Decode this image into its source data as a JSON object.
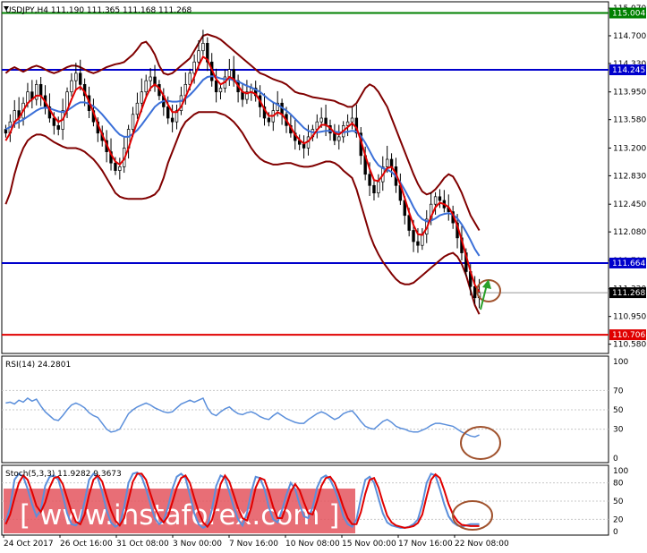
{
  "header": {
    "main": "USDJPY,H4  111.190 111.365 111.168 111.268",
    "rsi": "RSI(14) 24.2801",
    "stoch": "Stoch(5,3,3) 11.9282 9.3673"
  },
  "watermark": "[ www.instaforex.com ]",
  "colors": {
    "candle": "#000000",
    "bollinger": "#800000",
    "ma_fast": "#e00000",
    "ma_slow": "#3a6fd8",
    "resistance_green": "#008000",
    "level_blue": "#0000cc",
    "support_red": "#e00000",
    "rsi_line": "#5b8fdb",
    "stoch_main": "#5b8fdb",
    "stoch_signal": "#e00000",
    "circle": "#a0522d",
    "arrow": "#2aa02a",
    "watermark_band": "#e4555e"
  },
  "chart_data": [
    {
      "type": "candlestick",
      "title": "USDJPY,H4",
      "ohlc_current": {
        "open": 111.19,
        "high": 111.365,
        "low": 111.168,
        "close": 111.268
      },
      "price_axis_ticks": [
        "115.070",
        "114.700",
        "114.330",
        "113.950",
        "113.580",
        "113.200",
        "112.830",
        "112.450",
        "112.080",
        "111.700",
        "111.320",
        "110.950",
        "110.580"
      ],
      "ylim": [
        110.48,
        115.13
      ],
      "x_tick_labels": [
        "24 Oct 2017",
        "26 Oct 16:00",
        "31 Oct 08:00",
        "3 Nov 00:00",
        "7 Nov 16:00",
        "10 Nov 08:00",
        "15 Nov 00:00",
        "17 Nov 16:00",
        "22 Nov 08:00"
      ],
      "key_levels": [
        {
          "value": 115.004,
          "label": "115.004",
          "color": "#008000"
        },
        {
          "value": 114.245,
          "label": "114.245",
          "color": "#0000cc"
        },
        {
          "value": 111.664,
          "label": "111.664",
          "color": "#0000cc"
        },
        {
          "value": 110.706,
          "label": "110.706",
          "color": "#e00000"
        }
      ],
      "current_price": {
        "value": 111.268,
        "label": "111.268"
      },
      "closes": [
        113.4,
        113.55,
        113.7,
        113.6,
        113.8,
        113.95,
        113.85,
        114.05,
        113.9,
        113.75,
        113.6,
        113.5,
        113.45,
        113.7,
        113.95,
        114.1,
        114.2,
        114.05,
        113.9,
        113.7,
        113.55,
        113.4,
        113.3,
        113.15,
        113.0,
        112.9,
        112.95,
        113.2,
        113.45,
        113.65,
        113.8,
        113.95,
        114.1,
        114.15,
        114.05,
        113.9,
        113.75,
        113.6,
        113.55,
        113.7,
        113.9,
        114.05,
        114.2,
        114.35,
        114.5,
        114.6,
        114.35,
        114.1,
        113.95,
        114.0,
        114.15,
        114.25,
        114.1,
        113.95,
        113.85,
        113.95,
        114.0,
        113.9,
        113.75,
        113.6,
        113.55,
        113.7,
        113.8,
        113.65,
        113.5,
        113.4,
        113.3,
        113.25,
        113.2,
        113.35,
        113.45,
        113.55,
        113.6,
        113.5,
        113.4,
        113.3,
        113.35,
        113.5,
        113.55,
        113.6,
        113.4,
        113.1,
        112.85,
        112.7,
        112.6,
        112.75,
        112.95,
        113.05,
        112.95,
        112.7,
        112.5,
        112.3,
        112.1,
        111.95,
        111.9,
        112.05,
        112.25,
        112.45,
        112.55,
        112.5,
        112.4,
        112.35,
        112.2,
        112.0,
        111.8,
        111.55,
        111.35,
        111.2,
        111.27
      ],
      "ma_fast": [
        113.3,
        113.4,
        113.55,
        113.6,
        113.7,
        113.8,
        113.85,
        113.9,
        113.9,
        113.82,
        113.72,
        113.62,
        113.55,
        113.58,
        113.7,
        113.85,
        113.98,
        114.02,
        113.95,
        113.82,
        113.68,
        113.52,
        113.38,
        113.25,
        113.12,
        113.02,
        112.98,
        113.05,
        113.2,
        113.38,
        113.55,
        113.72,
        113.88,
        114.0,
        114.05,
        114.0,
        113.9,
        113.78,
        113.68,
        113.68,
        113.75,
        113.88,
        114.02,
        114.15,
        114.3,
        114.42,
        114.38,
        114.25,
        114.12,
        114.05,
        114.08,
        114.15,
        114.12,
        114.03,
        113.95,
        113.93,
        113.95,
        113.92,
        113.83,
        113.72,
        113.63,
        113.63,
        113.68,
        113.65,
        113.57,
        113.48,
        113.38,
        113.31,
        113.26,
        113.29,
        113.36,
        113.44,
        113.51,
        113.51,
        113.47,
        113.4,
        113.38,
        113.43,
        113.48,
        113.53,
        113.47,
        113.3,
        113.1,
        112.92,
        112.77,
        112.76,
        112.84,
        112.93,
        112.95,
        112.86,
        112.71,
        112.53,
        112.34,
        112.17,
        112.05,
        112.04,
        112.13,
        112.28,
        112.41,
        112.47,
        112.45,
        112.41,
        112.31,
        112.16,
        111.97,
        111.76,
        111.55,
        111.37,
        111.28
      ],
      "ma_slow": [
        113.45,
        113.48,
        113.52,
        113.55,
        113.58,
        113.62,
        113.66,
        113.7,
        113.73,
        113.74,
        113.73,
        113.71,
        113.69,
        113.68,
        113.7,
        113.74,
        113.78,
        113.81,
        113.81,
        113.79,
        113.76,
        113.71,
        113.65,
        113.58,
        113.51,
        113.44,
        113.38,
        113.35,
        113.35,
        113.39,
        113.44,
        113.51,
        113.59,
        113.67,
        113.75,
        113.8,
        113.83,
        113.83,
        113.82,
        113.82,
        113.83,
        113.86,
        113.91,
        113.97,
        114.04,
        114.11,
        114.15,
        114.16,
        114.15,
        114.13,
        114.12,
        114.12,
        114.11,
        114.09,
        114.06,
        114.03,
        114.01,
        113.98,
        113.95,
        113.9,
        113.85,
        113.81,
        113.78,
        113.74,
        113.7,
        113.65,
        113.59,
        113.53,
        113.47,
        113.43,
        113.41,
        113.41,
        113.42,
        113.43,
        113.43,
        113.42,
        113.41,
        113.41,
        113.42,
        113.43,
        113.42,
        113.36,
        113.27,
        113.16,
        113.05,
        112.97,
        112.93,
        112.91,
        112.88,
        112.82,
        112.74,
        112.64,
        112.53,
        112.41,
        112.31,
        112.25,
        112.22,
        112.23,
        112.26,
        112.3,
        112.32,
        112.33,
        112.31,
        112.26,
        112.18,
        112.08,
        111.97,
        111.85,
        111.76
      ],
      "bb_upper": [
        114.2,
        114.25,
        114.28,
        114.25,
        114.22,
        114.25,
        114.28,
        114.3,
        114.28,
        114.25,
        114.22,
        114.2,
        114.22,
        114.25,
        114.28,
        114.3,
        114.3,
        114.28,
        114.25,
        114.22,
        114.2,
        114.22,
        114.25,
        114.28,
        114.3,
        114.32,
        114.33,
        114.35,
        114.4,
        114.45,
        114.52,
        114.6,
        114.62,
        114.55,
        114.45,
        114.3,
        114.2,
        114.18,
        114.2,
        114.25,
        114.3,
        114.35,
        114.4,
        114.5,
        114.6,
        114.7,
        114.72,
        114.7,
        114.68,
        114.65,
        114.6,
        114.55,
        114.5,
        114.45,
        114.4,
        114.35,
        114.3,
        114.25,
        114.2,
        114.18,
        114.15,
        114.12,
        114.1,
        114.08,
        114.05,
        114.0,
        113.95,
        113.93,
        113.92,
        113.9,
        113.88,
        113.87,
        113.86,
        113.85,
        113.84,
        113.83,
        113.8,
        113.78,
        113.75,
        113.75,
        113.8,
        113.9,
        114.0,
        114.05,
        114.02,
        113.95,
        113.85,
        113.75,
        113.6,
        113.45,
        113.3,
        113.15,
        113.0,
        112.85,
        112.72,
        112.62,
        112.58,
        112.6,
        112.65,
        112.72,
        112.8,
        112.85,
        112.82,
        112.72,
        112.6,
        112.45,
        112.3,
        112.2,
        112.1
      ],
      "bb_lower": [
        112.45,
        112.6,
        112.85,
        113.05,
        113.2,
        113.3,
        113.35,
        113.38,
        113.38,
        113.36,
        113.32,
        113.28,
        113.25,
        113.22,
        113.2,
        113.2,
        113.2,
        113.18,
        113.15,
        113.1,
        113.05,
        112.98,
        112.9,
        112.8,
        112.7,
        112.6,
        112.55,
        112.53,
        112.52,
        112.52,
        112.52,
        112.52,
        112.53,
        112.55,
        112.58,
        112.65,
        112.8,
        113.0,
        113.15,
        113.3,
        113.45,
        113.55,
        113.6,
        113.65,
        113.68,
        113.68,
        113.68,
        113.68,
        113.68,
        113.66,
        113.64,
        113.6,
        113.55,
        113.48,
        113.4,
        113.3,
        113.2,
        113.12,
        113.06,
        113.02,
        113.0,
        112.98,
        112.98,
        112.99,
        113.0,
        113.0,
        112.98,
        112.96,
        112.95,
        112.95,
        112.96,
        112.98,
        113.0,
        113.02,
        113.02,
        113.0,
        112.96,
        112.9,
        112.85,
        112.8,
        112.65,
        112.45,
        112.25,
        112.05,
        111.9,
        111.78,
        111.68,
        111.6,
        111.52,
        111.45,
        111.4,
        111.38,
        111.38,
        111.4,
        111.45,
        111.5,
        111.55,
        111.6,
        111.65,
        111.7,
        111.75,
        111.78,
        111.8,
        111.75,
        111.65,
        111.5,
        111.3,
        111.1,
        110.98
      ]
    },
    {
      "type": "line",
      "title": "RSI(14) 24.2801",
      "y_ticks": [
        "100",
        "70",
        "50",
        "30",
        "0"
      ],
      "ylim": [
        0,
        100
      ],
      "levels": [
        70,
        50,
        30
      ],
      "series": [
        {
          "name": "RSI(14)",
          "values": [
            57,
            58,
            56,
            60,
            58,
            62,
            59,
            61,
            54,
            48,
            44,
            40,
            39,
            44,
            50,
            55,
            57,
            55,
            52,
            47,
            44,
            42,
            36,
            30,
            27,
            28,
            30,
            38,
            46,
            50,
            53,
            55,
            57,
            55,
            52,
            50,
            48,
            47,
            48,
            52,
            56,
            58,
            60,
            58,
            60,
            62,
            52,
            46,
            44,
            48,
            51,
            53,
            49,
            46,
            45,
            47,
            48,
            46,
            43,
            41,
            40,
            44,
            47,
            44,
            41,
            39,
            37,
            36,
            36,
            40,
            43,
            46,
            48,
            46,
            43,
            40,
            42,
            46,
            48,
            49,
            44,
            38,
            33,
            31,
            30,
            34,
            38,
            40,
            37,
            33,
            31,
            30,
            28,
            27,
            27,
            29,
            31,
            34,
            36,
            36,
            35,
            34,
            33,
            30,
            27,
            25,
            23,
            22,
            24
          ]
        }
      ]
    },
    {
      "type": "line",
      "title": "Stoch(5,3,3) 11.9282 9.3673",
      "y_ticks": [
        "100",
        "80",
        "50",
        "20",
        "0"
      ],
      "ylim": [
        0,
        100
      ],
      "levels": [
        80,
        50,
        20
      ],
      "series": [
        {
          "name": "%K",
          "values": [
            15,
            40,
            85,
            95,
            90,
            70,
            45,
            25,
            35,
            75,
            90,
            92,
            85,
            60,
            30,
            12,
            10,
            18,
            50,
            85,
            95,
            88,
            65,
            35,
            15,
            8,
            12,
            40,
            80,
            95,
            97,
            90,
            70,
            45,
            22,
            12,
            18,
            40,
            70,
            90,
            95,
            88,
            60,
            30,
            12,
            6,
            10,
            35,
            75,
            92,
            88,
            65,
            40,
            20,
            10,
            30,
            65,
            90,
            88,
            70,
            40,
            20,
            15,
            35,
            60,
            80,
            70,
            45,
            25,
            22,
            40,
            72,
            88,
            92,
            85,
            70,
            50,
            25,
            12,
            8,
            20,
            55,
            85,
            90,
            80,
            55,
            30,
            15,
            10,
            8,
            6,
            6,
            8,
            12,
            20,
            45,
            80,
            95,
            92,
            70,
            45,
            25,
            15,
            10,
            8,
            10,
            12,
            12,
            12
          ]
        },
        {
          "name": "%D",
          "values": [
            12,
            28,
            55,
            80,
            92,
            85,
            65,
            42,
            32,
            48,
            72,
            88,
            90,
            78,
            55,
            32,
            16,
            12,
            28,
            60,
            85,
            92,
            82,
            58,
            35,
            18,
            10,
            22,
            52,
            82,
            95,
            95,
            85,
            62,
            40,
            24,
            15,
            25,
            48,
            72,
            88,
            92,
            80,
            55,
            32,
            15,
            8,
            18,
            45,
            78,
            92,
            82,
            60,
            38,
            22,
            18,
            40,
            72,
            88,
            85,
            65,
            40,
            22,
            22,
            42,
            65,
            78,
            68,
            48,
            30,
            28,
            50,
            75,
            88,
            90,
            80,
            62,
            40,
            22,
            12,
            12,
            32,
            62,
            85,
            88,
            72,
            48,
            26,
            15,
            10,
            8,
            6,
            7,
            9,
            14,
            28,
            58,
            85,
            94,
            88,
            68,
            45,
            28,
            17,
            11,
            10,
            9,
            9,
            9
          ]
        }
      ]
    }
  ]
}
